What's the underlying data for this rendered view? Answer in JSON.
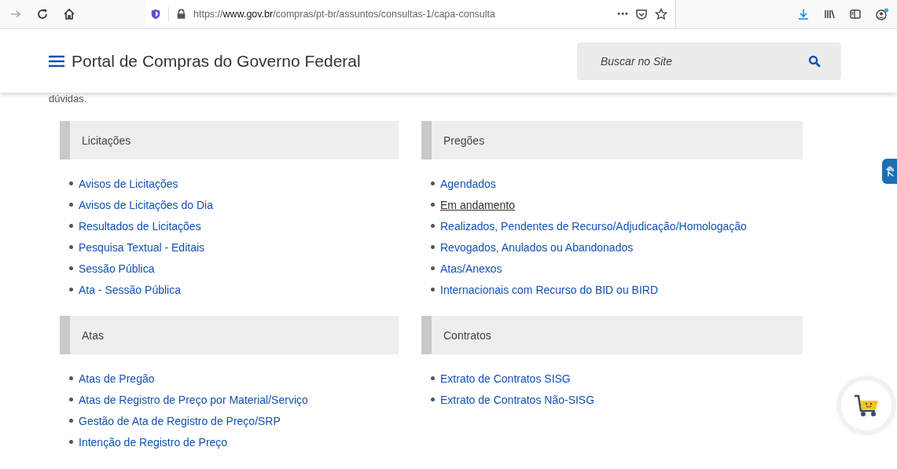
{
  "browser": {
    "url_prefix": "https://",
    "url_domain": "www.gov.br",
    "url_path": "/compras/pt-br/assuntos/consultas-1/capa-consulta",
    "more": "•••"
  },
  "header": {
    "title": "Portal de Compras do Governo Federal",
    "search": {
      "placeholder": "Buscar no Site"
    }
  },
  "intro_text": "dúvidas.",
  "sections": [
    {
      "title": "Licitações",
      "items": [
        {
          "label": "Avisos de Licitações",
          "hovered": false
        },
        {
          "label": "Avisos de Licitações do Dia",
          "hovered": false
        },
        {
          "label": "Resultados de Licitações",
          "hovered": false
        },
        {
          "label": "Pesquisa Textual - Editais",
          "hovered": false
        },
        {
          "label": "Sessão Pública",
          "hovered": false
        },
        {
          "label": "Ata - Sessão Pública",
          "hovered": false
        }
      ]
    },
    {
      "title": "Pregões",
      "items": [
        {
          "label": "Agendados",
          "hovered": false
        },
        {
          "label": "Em andamento",
          "hovered": true
        },
        {
          "label": "Realizados, Pendentes de Recurso/Adjudicação/Homologação",
          "hovered": false
        },
        {
          "label": "Revogados, Anulados ou Abandonados",
          "hovered": false
        },
        {
          "label": "Atas/Anexos",
          "hovered": false
        },
        {
          "label": "Internacionais com Recurso do BID ou BIRD",
          "hovered": false
        }
      ]
    },
    {
      "title": "Atas",
      "items": [
        {
          "label": "Atas de Pregão",
          "hovered": false
        },
        {
          "label": "Atas de Registro de Preço por Material/Serviço",
          "hovered": false
        },
        {
          "label": "Gestão de Ata de Registro de Preço/SRP",
          "hovered": false
        },
        {
          "label": "Intenção de Registro de Preço",
          "hovered": false
        }
      ]
    },
    {
      "title": "Contratos",
      "items": [
        {
          "label": "Extrato de Contratos SISG",
          "hovered": false
        },
        {
          "label": "Extrato de Contratos Não-SISG",
          "hovered": false
        }
      ]
    }
  ]
}
